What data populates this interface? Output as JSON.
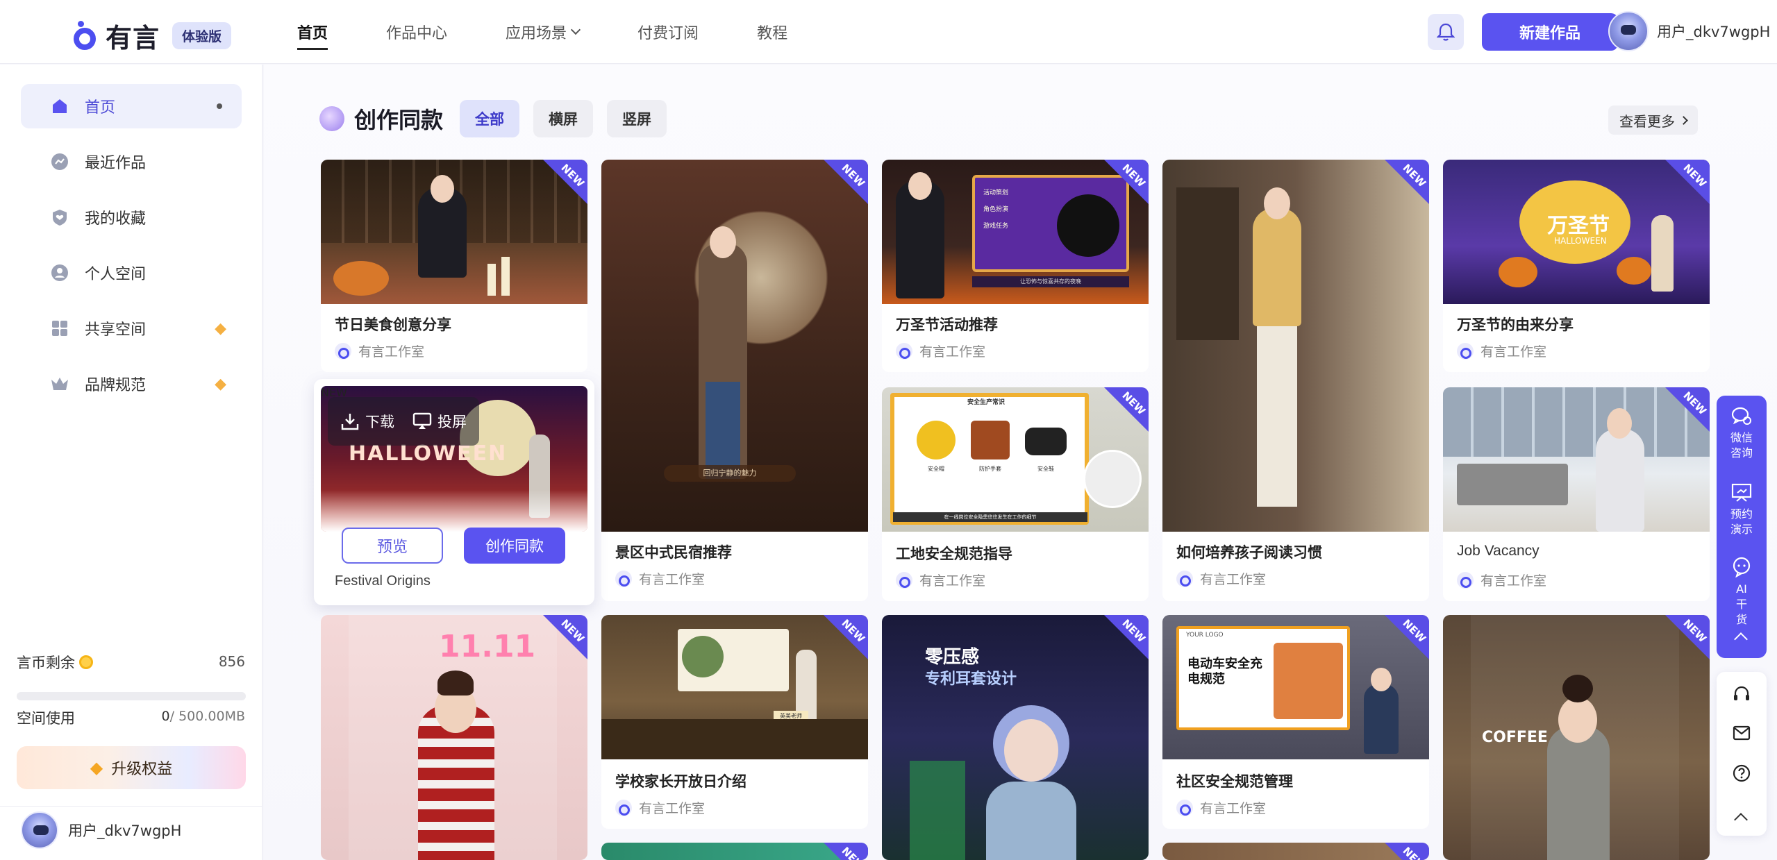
{
  "brand": {
    "name": "有言",
    "edition_badge": "体验版"
  },
  "nav": [
    {
      "label": "首页",
      "active": true
    },
    {
      "label": "作品中心"
    },
    {
      "label": "应用场景",
      "dropdown": true
    },
    {
      "label": "付费订阅"
    },
    {
      "label": "教程"
    }
  ],
  "header": {
    "bell_icon": "bell-icon",
    "new_button": "新建作品",
    "user_name": "用户_dkv7wgpH"
  },
  "sidebar": {
    "items": [
      {
        "label": "首页",
        "icon": "home-icon",
        "active": true
      },
      {
        "label": "最近作品",
        "icon": "recent-icon"
      },
      {
        "label": "我的收藏",
        "icon": "favorite-icon"
      },
      {
        "label": "个人空间",
        "icon": "person-icon"
      },
      {
        "label": "共享空间",
        "icon": "grid-icon",
        "premium": true
      },
      {
        "label": "品牌规范",
        "icon": "crown-icon",
        "premium": true
      }
    ],
    "balance_label": "言币剩余",
    "balance_value": "856",
    "space_label": "空间使用",
    "space_used": "0",
    "space_total": "/ 500.00MB",
    "space_fraction": 0,
    "upgrade_label": "升级权益",
    "user_name": "用户_dkv7wgpH"
  },
  "section": {
    "title": "创作同款",
    "filters": [
      "全部",
      "横屏",
      "竖屏"
    ],
    "more": "查看更多"
  },
  "new_tag": "NEW",
  "author": "有言工作室",
  "cards": {
    "c1": "节日美食创意分享",
    "c2": "景区中式民宿推荐",
    "c3": "万圣节活动推荐",
    "c4": "如何培养孩子阅读习惯",
    "c5": "万圣节的由来分享",
    "c6": "工地安全规范指导",
    "c7": "Job Vacancy",
    "c8": "学校家长开放日介绍",
    "c9": "社区安全规范管理",
    "hover": "Festival Origins"
  },
  "thumb_text": {
    "c2_caption": "回归宁静的魅力",
    "c3_menu": [
      "活动策划",
      "角色扮演",
      "游戏任务"
    ],
    "c3_banner": "让恐怖与惊喜共存的夜晚",
    "c5_title": "万圣节",
    "c5_sub": "HALLOWEEN",
    "c6_banner": "安全生产常识",
    "c6_items": [
      "安全帽",
      "防护手套",
      "安全鞋"
    ],
    "c6_caption": "在一线岗位安全隐患往往发生在工作的细节",
    "c8_teacher": "英美老师",
    "c9_logo": "YOUR LOGO",
    "c9_title": "电动车安全充电规范",
    "c11_eleven": "11.11",
    "c12_title": "零压感",
    "c12_sub": "专利耳套设计",
    "c13_coffee": "COFFEE",
    "hover_title": "HALLOWEEN"
  },
  "hover_tools": {
    "download": "下载",
    "cast": "投屏",
    "preview": "预览",
    "create": "创作同款"
  },
  "float_bar": [
    {
      "label": "微信咨询",
      "icon": "wechat-consult-icon"
    },
    {
      "label": "预约演示",
      "icon": "demo-icon"
    },
    {
      "label": "AI干货",
      "icon": "ai-chat-icon"
    }
  ],
  "float_bar2_icons": [
    "headset-icon",
    "mail-icon",
    "help-icon",
    "back-to-top-icon"
  ]
}
